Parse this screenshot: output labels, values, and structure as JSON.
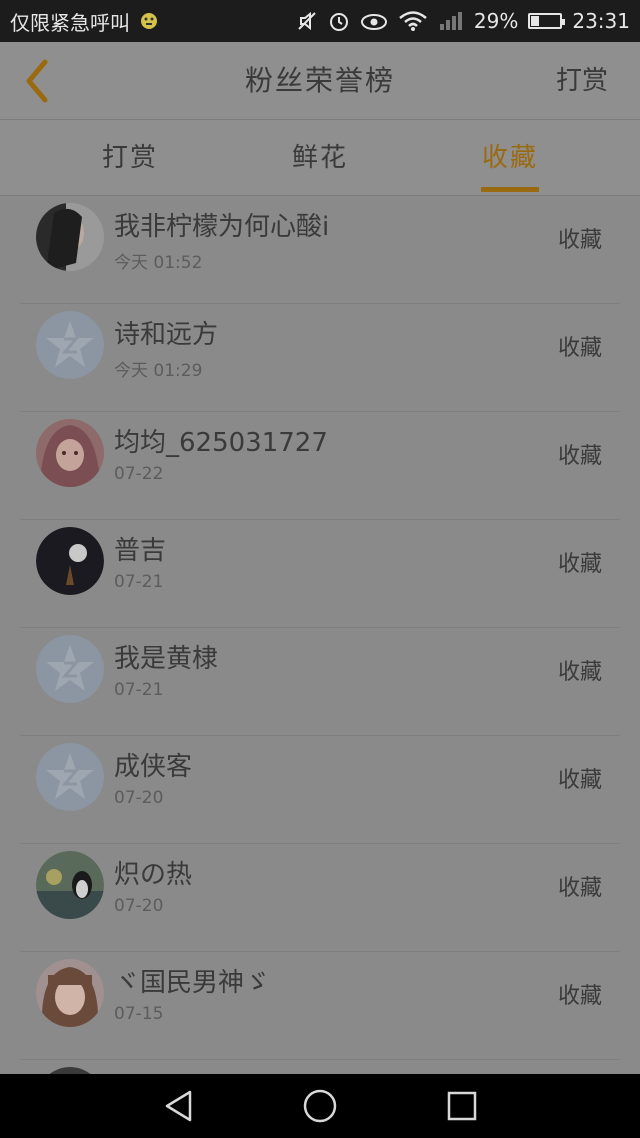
{
  "status_bar": {
    "carrier_text": "仅限紧急呼叫",
    "battery": "29%",
    "time": "23:31",
    "icons": [
      "face-icon",
      "mute-icon",
      "alarm-icon",
      "eye-icon",
      "wifi-icon",
      "signal-icon",
      "battery-icon"
    ],
    "battery_level": 0.29
  },
  "header": {
    "back_icon": "chevron-left-icon",
    "title": "粉丝荣誉榜",
    "action": "打赏"
  },
  "tabs": [
    {
      "label": "打赏",
      "active": false
    },
    {
      "label": "鲜花",
      "active": false
    },
    {
      "label": "收藏",
      "active": true
    }
  ],
  "list": [
    {
      "name": "我非柠檬为何心酸i",
      "time": "今天 01:52",
      "action": "收藏",
      "avatar": "photo-avatar"
    },
    {
      "name": "诗和远方",
      "time": "今天 01:29",
      "action": "收藏",
      "avatar": "default-q-avatar"
    },
    {
      "name": "均均_625031727",
      "time": "07-22",
      "action": "收藏",
      "avatar": "anime-avatar"
    },
    {
      "name": "普吉",
      "time": "07-21",
      "action": "收藏",
      "avatar": "moon-avatar"
    },
    {
      "name": "我是黄棣",
      "time": "07-21",
      "action": "收藏",
      "avatar": "default-q-avatar"
    },
    {
      "name": "成侠客",
      "time": "07-20",
      "action": "收藏",
      "avatar": "default-q-avatar"
    },
    {
      "name": "炽の热",
      "time": "07-20",
      "action": "收藏",
      "avatar": "penguin-avatar"
    },
    {
      "name": "ヾ国民男神ゞ",
      "time": "07-15",
      "action": "收藏",
      "avatar": "girl-avatar"
    }
  ],
  "colors": {
    "accent": "#9a6a10",
    "overlay_background": "#8a8a8a",
    "text": "#3a3a3a"
  },
  "bottom_nav": [
    "back-triangle-icon",
    "home-circle-icon",
    "recent-square-icon"
  ]
}
